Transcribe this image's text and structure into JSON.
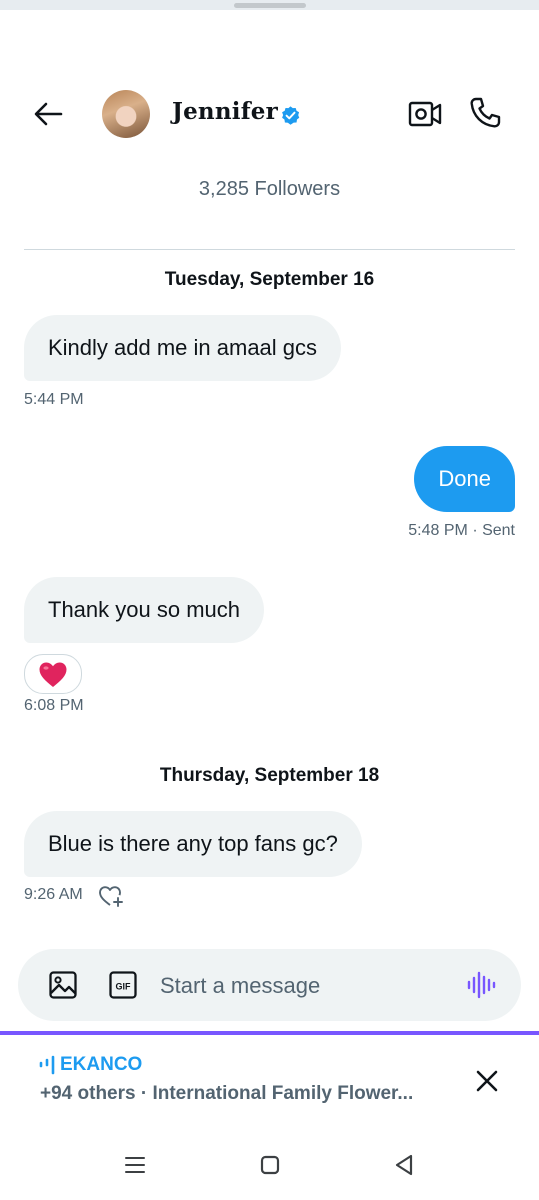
{
  "header": {
    "contact_name": "Jennifer",
    "icons": [
      "back-arrow-icon",
      "verified-badge-icon",
      "video-call-icon",
      "phone-call-icon"
    ]
  },
  "profile": {
    "followers": "3,285 Followers"
  },
  "messages": [
    {
      "type": "date",
      "text": "Tuesday, September 16"
    },
    {
      "type": "incoming",
      "text": "Kindly add me in amaal gcs",
      "time": "5:44 PM"
    },
    {
      "type": "outgoing",
      "text": "Done",
      "time": "5:48 PM · Sent"
    },
    {
      "type": "incoming",
      "text": "Thank you so much",
      "time": "6:08 PM",
      "reaction": "❤️"
    },
    {
      "type": "date",
      "text": "Thursday, September 18"
    },
    {
      "type": "incoming",
      "text": "Blue is there any top fans gc?",
      "time": "9:26 AM"
    }
  ],
  "composer": {
    "placeholder": "Start a message",
    "gif_label": "GIF",
    "icons": [
      "image-icon",
      "gif-icon",
      "voice-message-icon"
    ]
  },
  "banner": {
    "brand": "EKANCO",
    "subtitle": "+94 others · International Family Flower...",
    "icons": [
      "audio-space-icon",
      "close-icon"
    ]
  },
  "colors": {
    "accent": "#1d9bf0",
    "bubble_incoming": "#eff3f4",
    "secondary_text": "#536471",
    "banner_line": "#7856ff",
    "voice_icon": "#7856ff"
  }
}
